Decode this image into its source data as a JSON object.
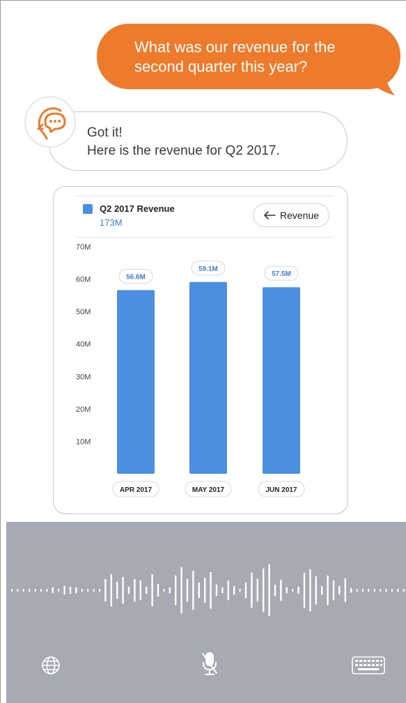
{
  "conversation": {
    "user_message": "What was our revenue for the second quarter this year?",
    "bot_reply_line1": "Got it!",
    "bot_reply_line2": "Here is the revenue for Q2 2017."
  },
  "card": {
    "legend_title": "Q2 2017 Revenue",
    "legend_value": "173M",
    "back_button_label": "Revenue"
  },
  "colors": {
    "user_bubble": "#ee7a2b",
    "bar": "#4a8fe0",
    "voice_panel": "#a5aab3"
  },
  "chart_data": {
    "type": "bar",
    "categories": [
      "APR 2017",
      "MAY 2017",
      "JUN 2017"
    ],
    "values": [
      56.6,
      59.1,
      57.5
    ],
    "value_labels": [
      "56.6M",
      "59.1M",
      "57.5M"
    ],
    "y_ticks": [
      "10M",
      "20M",
      "30M",
      "40M",
      "50M",
      "60M",
      "70M"
    ],
    "ylim": [
      0,
      70
    ],
    "grid": false
  },
  "voice": {
    "state": "listening",
    "icons": [
      "globe-icon",
      "mic-off-icon",
      "keyboard-icon"
    ]
  }
}
